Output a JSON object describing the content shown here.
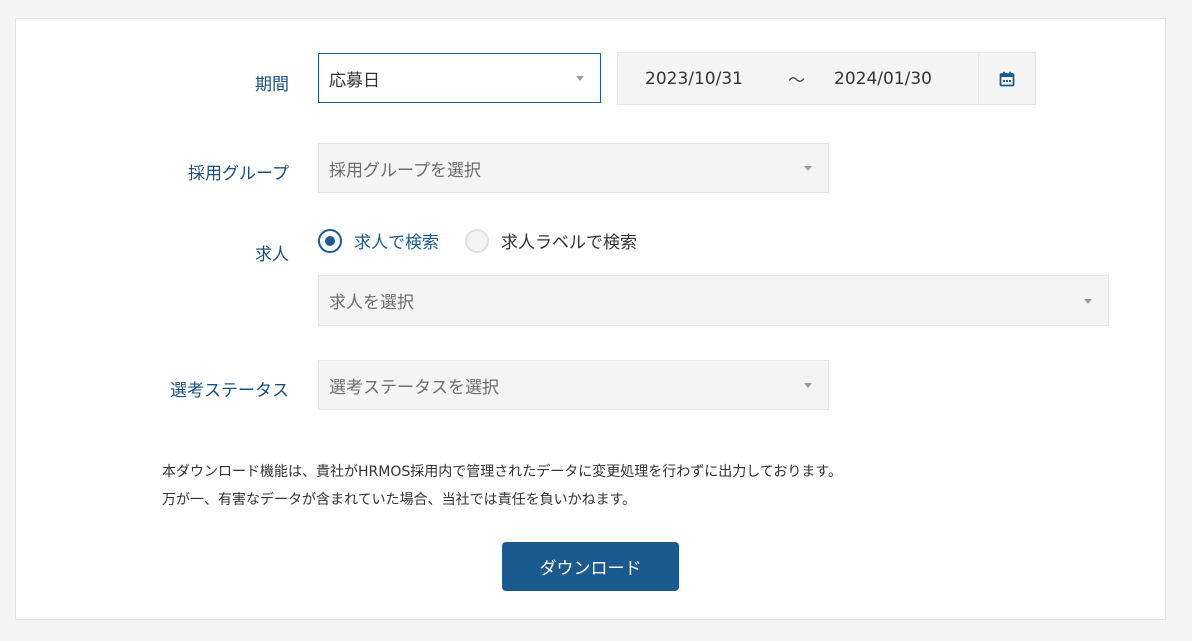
{
  "form": {
    "period": {
      "label": "期間",
      "type_select": "応募日",
      "date_start": "2023/10/31",
      "date_separator": "〜",
      "date_end": "2024/01/30"
    },
    "recruit_group": {
      "label": "採用グループ",
      "placeholder": "採用グループを選択"
    },
    "job": {
      "label": "求人",
      "radio_options": [
        {
          "label": "求人で検索",
          "checked": true
        },
        {
          "label": "求人ラベルで検索",
          "checked": false
        }
      ],
      "placeholder": "求人を選択"
    },
    "status": {
      "label": "選考ステータス",
      "placeholder": "選考ステータスを選択"
    }
  },
  "notice": {
    "line1": "本ダウンロード機能は、貴社がHRMOS採用内で管理されたデータに変更処理を行わずに出力しております。",
    "line2": "万が一、有害なデータが含まれていた場合、当社では責任を負いかねます。"
  },
  "download_button": "ダウンロード",
  "colors": {
    "accent": "#1b5a8f",
    "label": "#1b4f82",
    "field_bg": "#f4f4f4"
  }
}
